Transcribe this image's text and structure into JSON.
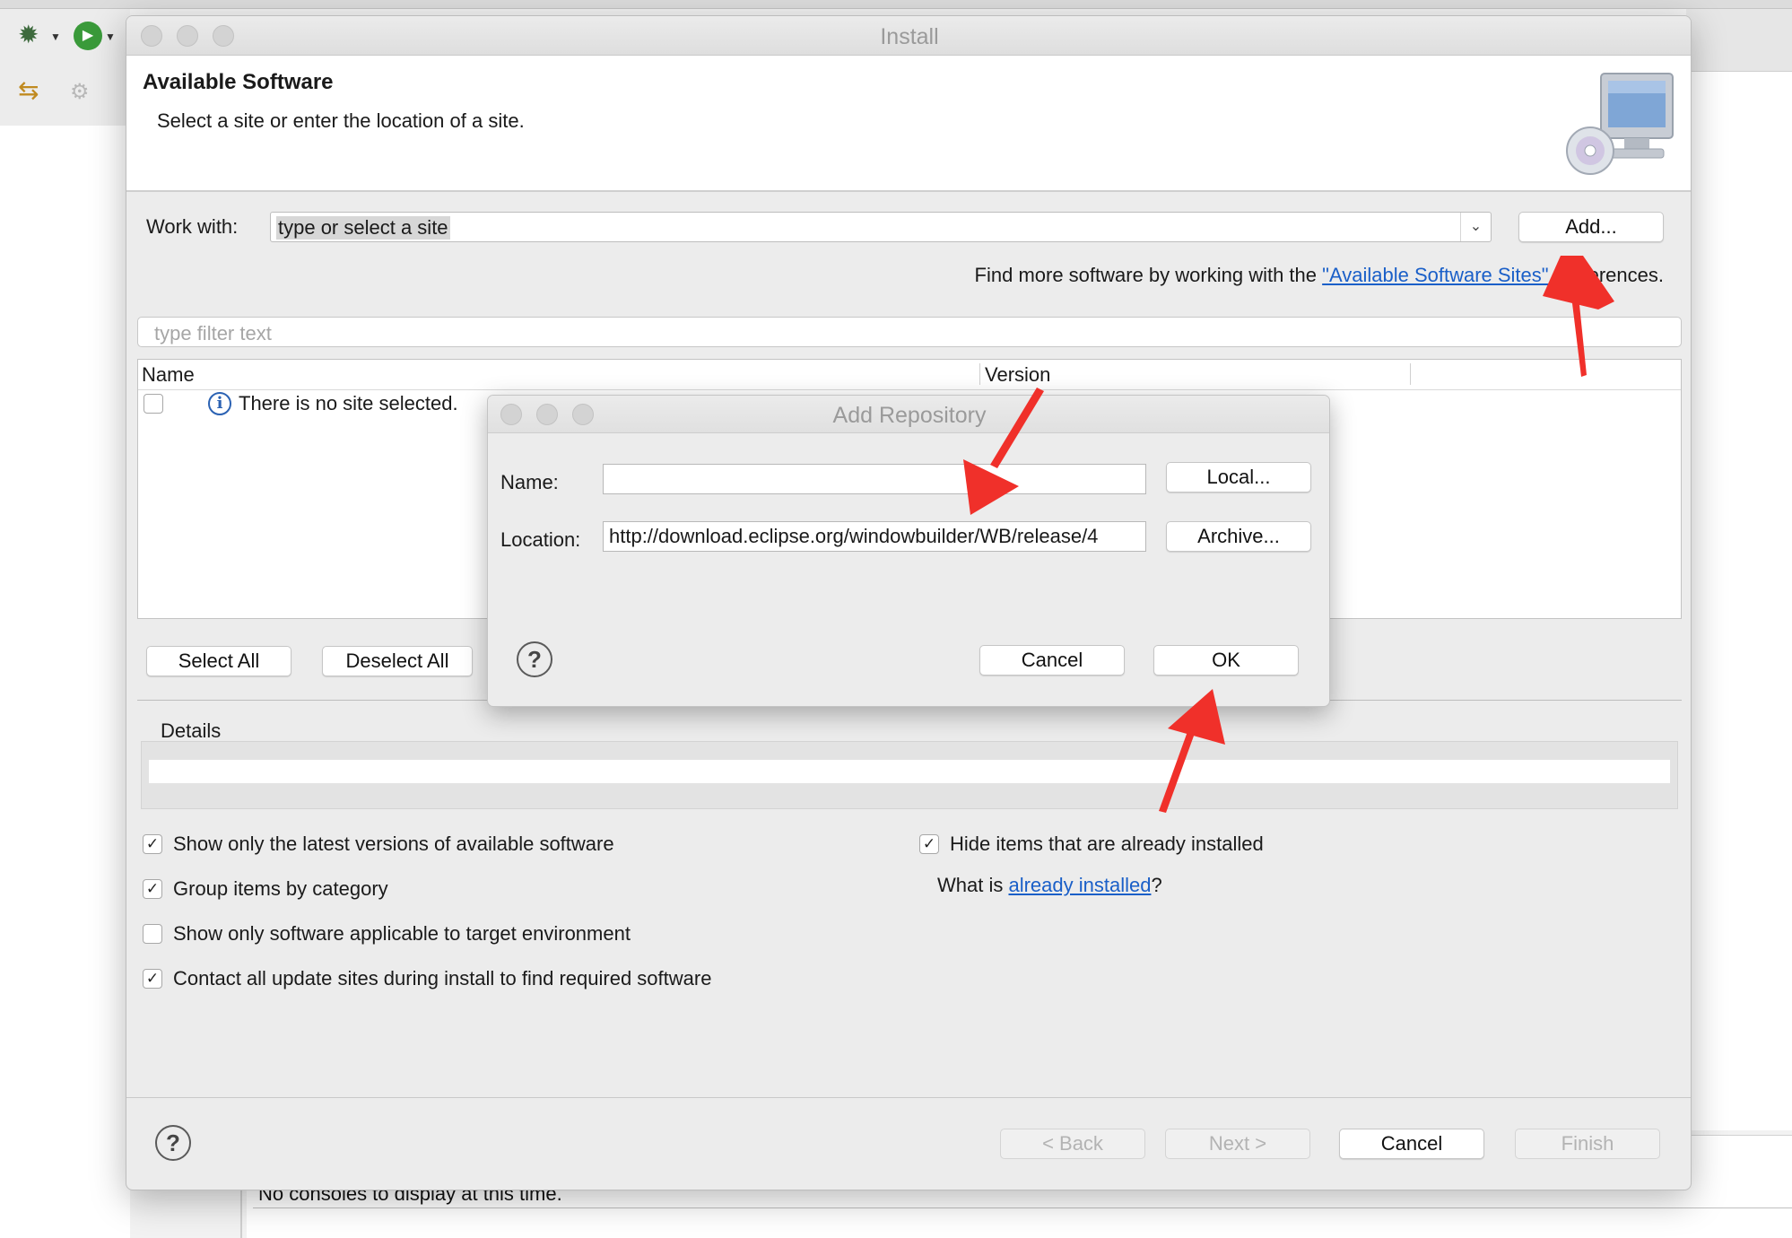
{
  "background": {
    "console_message": "No consoles to display at this time."
  },
  "install_dialog": {
    "window_title": "Install",
    "header": {
      "title": "Available Software",
      "subtitle": "Select a site or enter the location of a site."
    },
    "work_with": {
      "label": "Work with:",
      "value": "type or select a site",
      "add_button": "Add..."
    },
    "find_more": {
      "prefix": "Find more software by working with the ",
      "link": "\"Available Software Sites\"",
      "suffix": " preferences."
    },
    "filter": {
      "placeholder": "type filter text"
    },
    "table": {
      "columns": [
        "Name",
        "Version"
      ],
      "empty_message": "There is no site selected."
    },
    "select_all_button": "Select All",
    "deselect_all_button": "Deselect All",
    "details_label": "Details",
    "options": {
      "show_latest": {
        "label": "Show only the latest versions of available software",
        "checked": true
      },
      "group_by_category": {
        "label": "Group items by category",
        "checked": true
      },
      "show_applicable": {
        "label": "Show only software applicable to target environment",
        "checked": false
      },
      "contact_sites": {
        "label": "Contact all update sites during install to find required software",
        "checked": true
      },
      "hide_installed": {
        "label": "Hide items that are already installed",
        "checked": true
      }
    },
    "what_is": {
      "prefix": "What is ",
      "link": "already installed",
      "suffix": "?"
    },
    "footer": {
      "back": "< Back",
      "next": "Next >",
      "cancel": "Cancel",
      "finish": "Finish"
    }
  },
  "add_repository_dialog": {
    "title": "Add Repository",
    "name_label": "Name:",
    "name_value": "",
    "location_label": "Location:",
    "location_value": "http://download.eclipse.org/windowbuilder/WB/release/4",
    "local_button": "Local...",
    "archive_button": "Archive...",
    "cancel_button": "Cancel",
    "ok_button": "OK"
  },
  "colors": {
    "link": "#1a5fc8",
    "annotation_arrow": "#f0302a",
    "info_icon": "#2b62b3"
  }
}
